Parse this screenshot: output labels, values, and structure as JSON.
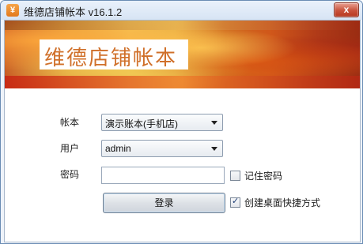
{
  "window": {
    "title": "维德店铺帐本 v16.1.2",
    "app_icon_glyph": "¥",
    "close_glyph": "x"
  },
  "banner": {
    "title": "维德店铺帐本"
  },
  "form": {
    "account_label": "帐本",
    "account_value": "演示账本(手机店)",
    "user_label": "用户",
    "user_value": "admin",
    "password_label": "密码",
    "password_value": "",
    "remember_label": "记住密码",
    "remember_checked": false,
    "shortcut_label": "创建桌面快捷方式",
    "shortcut_checked": true,
    "login_label": "登录"
  },
  "colors": {
    "banner_title": "#d0702a",
    "close_button": "#c8523b"
  }
}
